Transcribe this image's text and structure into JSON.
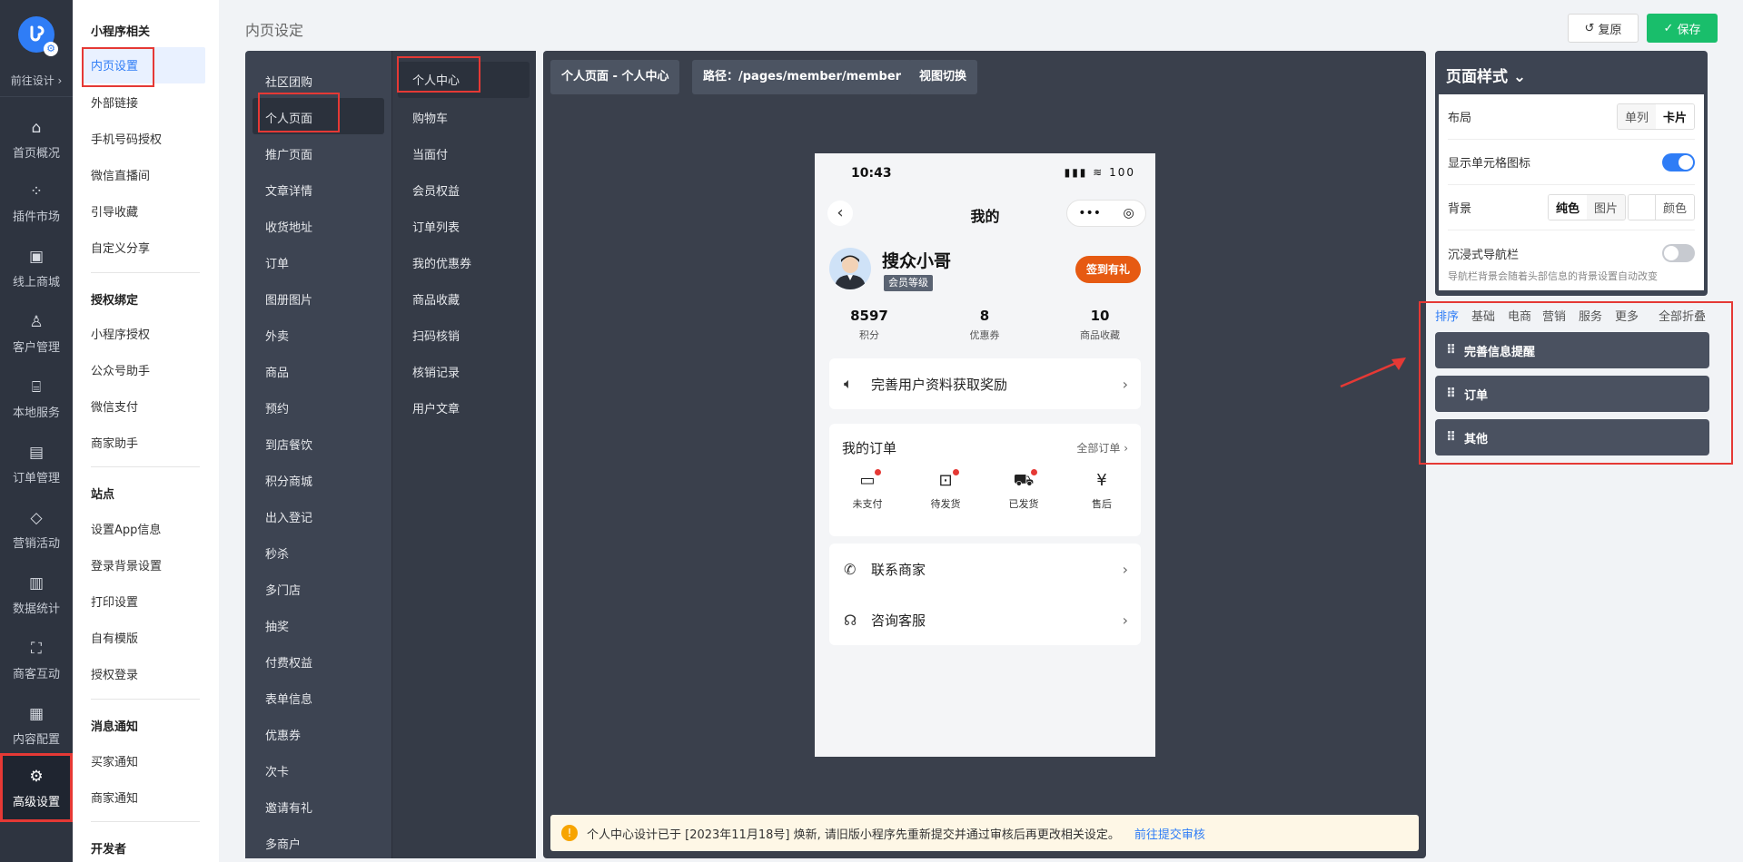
{
  "rail": {
    "design": "前往设计 ›",
    "items": [
      {
        "label": "首页概况",
        "icon": "home-icon"
      },
      {
        "label": "插件市场",
        "icon": "grid-icon"
      },
      {
        "label": "线上商城",
        "icon": "store-icon"
      },
      {
        "label": "客户管理",
        "icon": "user-icon"
      },
      {
        "label": "本地服务",
        "icon": "shop-icon"
      },
      {
        "label": "订单管理",
        "icon": "clipboard-icon"
      },
      {
        "label": "营销活动",
        "icon": "diamond-icon"
      },
      {
        "label": "数据统计",
        "icon": "chart-icon"
      },
      {
        "label": "商客互动",
        "icon": "scan-icon"
      },
      {
        "label": "内容配置",
        "icon": "document-icon"
      },
      {
        "label": "高级设置",
        "icon": "gear-icon"
      }
    ]
  },
  "sidebar": {
    "groups": [
      {
        "title": "小程序相关",
        "links": [
          "内页设置",
          "外部链接",
          "手机号码授权",
          "微信直播间",
          "引导收藏",
          "自定义分享"
        ]
      },
      {
        "title": "授权绑定",
        "links": [
          "小程序授权",
          "公众号助手",
          "微信支付",
          "商家助手"
        ]
      },
      {
        "title": "站点",
        "links": [
          "设置App信息",
          "登录背景设置",
          "打印设置",
          "自有模版",
          "授权登录"
        ]
      },
      {
        "title": "消息通知",
        "links": [
          "买家通知",
          "商家通知"
        ]
      },
      {
        "title": "开发者",
        "links": []
      }
    ]
  },
  "header": {
    "breadcrumb": "内页设定",
    "restore": "复原",
    "save": "保存"
  },
  "page_menu": {
    "col1": [
      "社区团购",
      "个人页面",
      "推广页面",
      "文章详情",
      "收货地址",
      "订单",
      "图册图片",
      "外卖",
      "商品",
      "预约",
      "到店餐饮",
      "积分商城",
      "出入登记",
      "秒杀",
      "多门店",
      "抽奖",
      "付费权益",
      "表单信息",
      "优惠券",
      "次卡",
      "邀请有礼",
      "多商户"
    ],
    "col2": [
      "个人中心",
      "购物车",
      "当面付",
      "会员权益",
      "订单列表",
      "我的优惠券",
      "商品收藏",
      "扫码核销",
      "核销记录",
      "用户文章"
    ]
  },
  "canvas": {
    "page_tag": "个人页面 - 个人中心",
    "path_tag": "路径：/pages/member/member",
    "view_switch": "视图切换",
    "notice": "个人中心设计已于 [2023年11月18号] 焕新, 请旧版小程序先重新提交并通过审核后再更改相关设定。",
    "notice_link": "前往提交审核"
  },
  "phone": {
    "time": "10:43",
    "signal": "▮▮▮ ≋ 100",
    "title": "我的",
    "back": "‹",
    "caps_more": "•••",
    "caps_close": "◎",
    "user_name": "搜众小哥",
    "level": "会员等级",
    "sign_btn": "签到有礼",
    "stats": [
      {
        "value": "8597",
        "label": "积分"
      },
      {
        "value": "8",
        "label": "优惠券"
      },
      {
        "value": "10",
        "label": "商品收藏"
      }
    ],
    "profile_tip": "完善用户资料获取奖励",
    "orders_title": "我的订单",
    "orders_all": "全部订单 ›",
    "orders": [
      {
        "label": "未支付",
        "icon": "card-icon",
        "dot": true
      },
      {
        "label": "待发货",
        "icon": "box-icon",
        "dot": true
      },
      {
        "label": "已发货",
        "icon": "truck-icon",
        "dot": true
      },
      {
        "label": "售后",
        "icon": "yuan-icon",
        "dot": false
      }
    ],
    "contact": "联系商家",
    "service": "咨询客服",
    "chev": "›"
  },
  "style_panel": {
    "title": "页面样式 ⌄",
    "layout_label": "布局",
    "layout_opts": [
      "单列",
      "卡片"
    ],
    "show_icon_label": "显示单元格图标",
    "bg_label": "背景",
    "bg_opts": [
      "纯色",
      "图片"
    ],
    "color_label": "颜色",
    "immersive_label": "沉浸式导航栏",
    "hint": "导航栏背景会随着头部信息的背景设置自动改变"
  },
  "sort_tabs": [
    "排序",
    "基础",
    "电商",
    "营销",
    "服务",
    "更多",
    "全部折叠"
  ],
  "sort_items": [
    "完善信息提醒",
    "订单",
    "其他"
  ],
  "colors": {
    "accent": "#2f7df6",
    "save": "#19be6b",
    "highlight": "#e53935"
  }
}
